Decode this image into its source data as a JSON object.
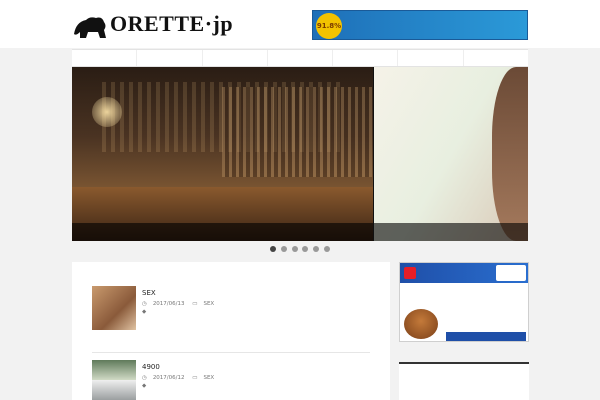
{
  "header": {
    "logo_text": "ORETTE",
    "logo_suffix": "jp",
    "logo_sub": "",
    "ad": {
      "badge": "91.8%",
      "top_line": "",
      "main_line": ""
    }
  },
  "nav": {
    "items": [
      "",
      "",
      "",
      "",
      "",
      "",
      ""
    ]
  },
  "slider": {
    "main_caption": "",
    "side_caption": "",
    "dots": 6,
    "active_dot": 0
  },
  "posts": [
    {
      "title": "SEX",
      "date": "2017/06/13",
      "category": "SEX",
      "tag": "",
      "excerpt": "",
      "more": ""
    },
    {
      "title": "4900",
      "date": "2017/06/12",
      "category": "SEX",
      "tag": "",
      "excerpt": "",
      "more": ""
    }
  ],
  "sidebar": {
    "ad": {
      "title": "",
      "line1": "",
      "line2": "",
      "line3": "",
      "line4": "",
      "cta": ""
    },
    "heading": ""
  },
  "colors": {
    "accent_blue": "#1f4fa8",
    "accent_red": "#e61e28",
    "link": "#2a5fb0"
  }
}
